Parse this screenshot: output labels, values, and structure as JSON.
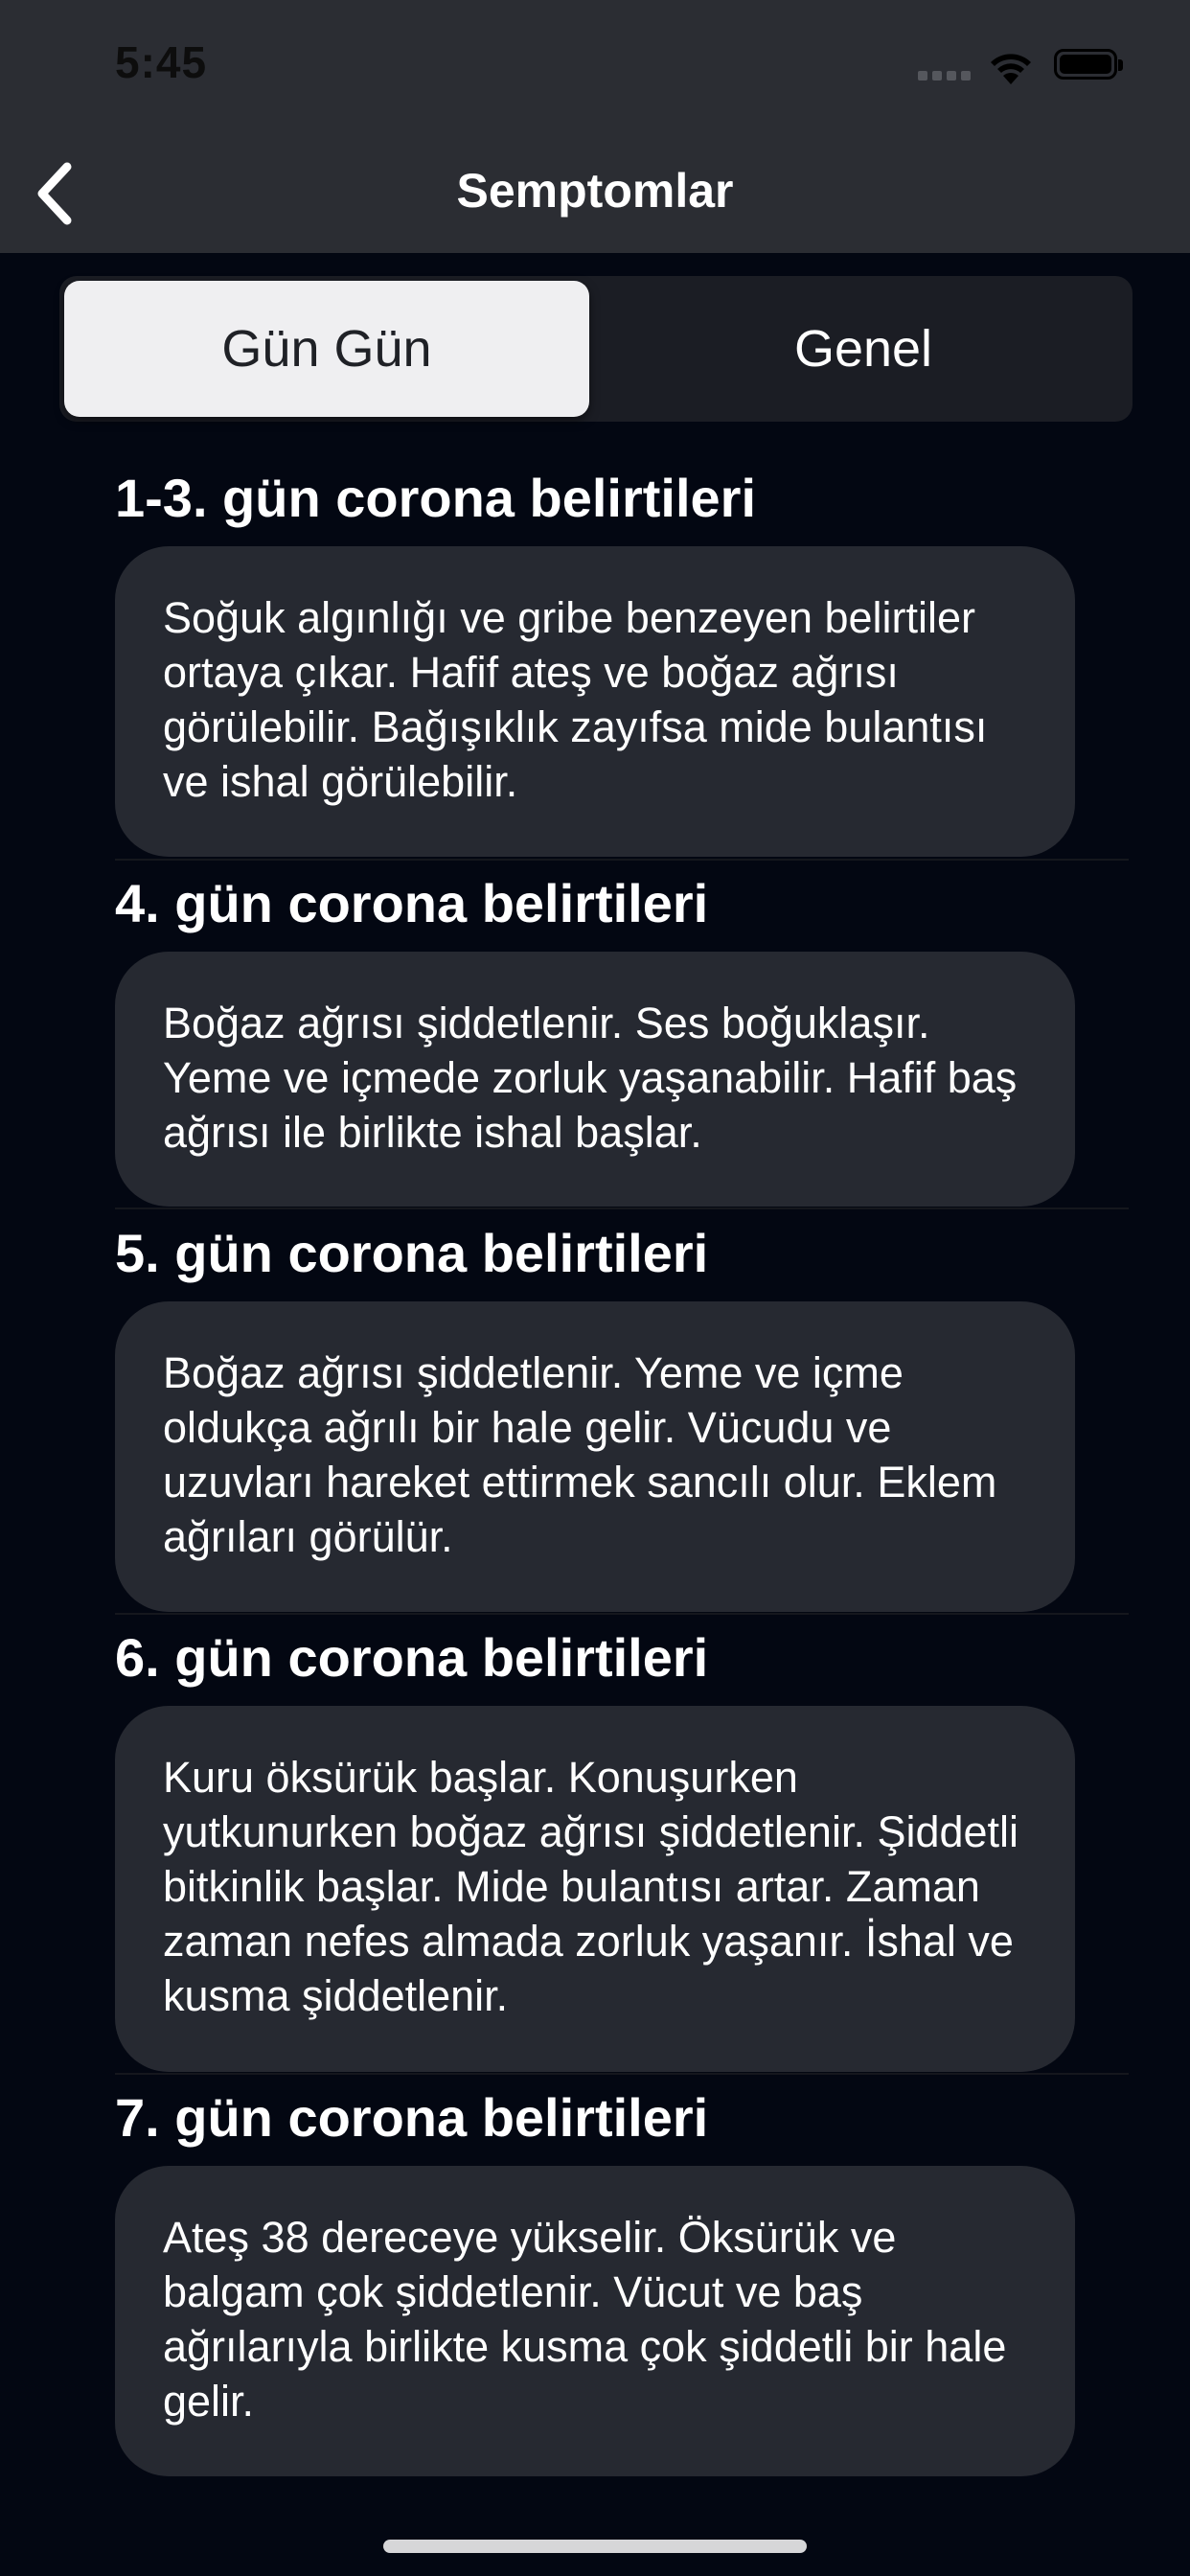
{
  "status_bar": {
    "time": "5:45"
  },
  "nav": {
    "title": "Semptomlar",
    "back_icon": "chevron-left-icon"
  },
  "segmented_control": {
    "segments": [
      {
        "label": "Gün Gün",
        "selected": true
      },
      {
        "label": "Genel",
        "selected": false
      }
    ]
  },
  "sections": [
    {
      "title": "1-3. gün corona belirtileri",
      "body": "Soğuk algınlığı ve gribe benzeyen belirtiler ortaya çıkar. Hafif ateş ve boğaz ağrısı görülebilir. Bağışıklık zayıfsa mide bulantısı ve ishal görülebilir."
    },
    {
      "title": "4. gün corona belirtileri",
      "body": "Boğaz ağrısı şiddetlenir. Ses boğuklaşır. Yeme ve içmede zorluk yaşanabilir. Hafif baş ağrısı ile birlikte ishal başlar."
    },
    {
      "title": "5. gün corona belirtileri",
      "body": "Boğaz ağrısı şiddetlenir. Yeme ve içme oldukça ağrılı bir hale gelir. Vücudu ve uzuvları hareket ettirmek sancılı olur. Eklem ağrıları görülür."
    },
    {
      "title": "6. gün corona belirtileri",
      "body": "Kuru öksürük başlar. Konuşurken yutkunurken boğaz ağrısı şiddetlenir. Şiddetli bitkinlik başlar. Mide bulantısı artar. Zaman zaman nefes almada zorluk yaşanır. İshal ve kusma şiddetlenir."
    },
    {
      "title": "7. gün corona belirtileri",
      "body": "Ateş 38 dereceye yükselir. Öksürük ve balgam çok şiddetlenir. Vücut ve baş ağrılarıyla birlikte kusma çok şiddetli bir hale gelir."
    }
  ],
  "colors": {
    "background": "#030712",
    "header": "#2b2d33",
    "card": "#262931",
    "segment_selected": "#efeff1"
  }
}
